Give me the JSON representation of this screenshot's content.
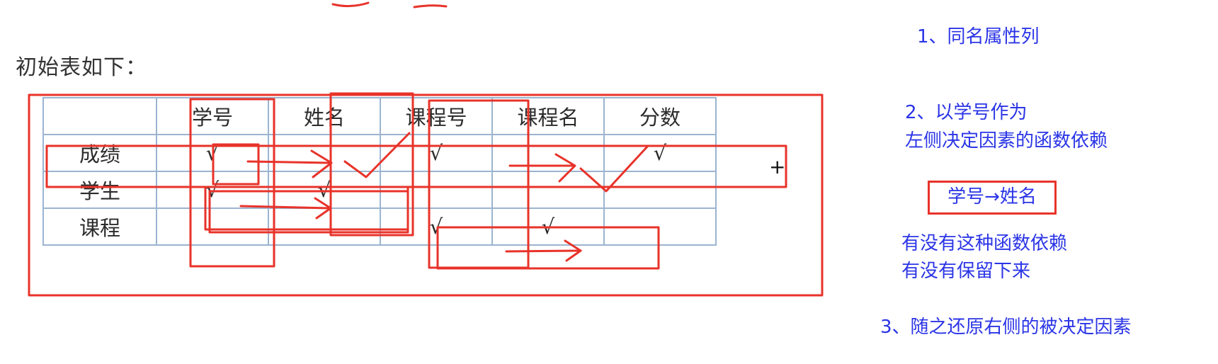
{
  "heading": "初始表如下：",
  "table": {
    "columns": [
      "",
      "学号",
      "姓名",
      "课程号",
      "课程名",
      "分数"
    ],
    "rows": [
      {
        "label": "成绩",
        "cells": [
          "√",
          "",
          "√",
          "",
          "√"
        ]
      },
      {
        "label": "学生",
        "cells": [
          "√",
          "√",
          "",
          "",
          ""
        ]
      },
      {
        "label": "课程",
        "cells": [
          "",
          "",
          "√",
          "√",
          ""
        ]
      }
    ]
  },
  "notes": {
    "n1": "1、同名属性列",
    "n2_line1": "2、以学号作为",
    "n2_line2": "左侧决定因素的函数依赖",
    "fd": "学号→姓名",
    "q_line1": "有没有这种函数依赖",
    "q_line2": "有没有保留下来",
    "n3": "3、随之还原右侧的被决定因素"
  },
  "colors": {
    "annotation_red": "#e8332a",
    "note_blue": "#2b35e6",
    "grid_blue": "#9bb4d0"
  }
}
